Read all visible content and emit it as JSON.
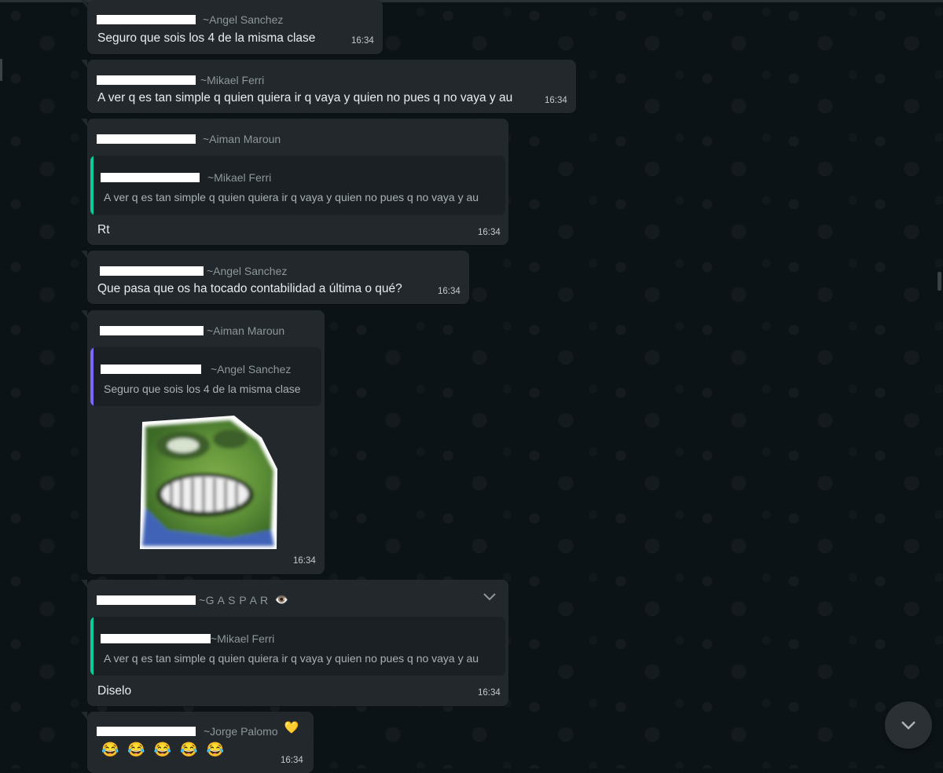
{
  "messages": [
    {
      "sender": "~Angel Sanchez",
      "text": "Seguro que sois los 4 de la misma clase",
      "time": "16:34"
    },
    {
      "sender": "~Mikael Ferri",
      "text": "A ver q es tan simple q quien quiera ir q vaya y quien no pues q no vaya y au",
      "time": "16:34"
    },
    {
      "sender": "~Aiman Maroun",
      "quote": {
        "sender": "~Mikael Ferri",
        "text": "A ver q es tan simple q quien quiera ir q vaya y quien no pues q no vaya y au"
      },
      "text": "Rt",
      "time": "16:34"
    },
    {
      "sender": "~Angel Sanchez",
      "text": "Que pasa que os ha tocado contabilidad a última o qué?",
      "time": "16:34"
    },
    {
      "sender": "~Aiman Maroun",
      "quote": {
        "sender": "~Angel Sanchez",
        "text": "Seguro que sois los 4 de la misma clase"
      },
      "sticker": "pepe-sticker",
      "time": "16:34"
    },
    {
      "sender": "~G A S P A R",
      "sender_emoji": "👁️",
      "quote": {
        "sender": "~Mikael Ferri",
        "text": "A ver q es tan simple q quien quiera ir q vaya y quien no pues q no vaya y au"
      },
      "text": "Diselo",
      "time": "16:34"
    },
    {
      "sender": "~Jorge Palomo",
      "sender_emoji": "💛",
      "emojis": [
        "😂",
        "😂",
        "😂",
        "😂",
        "😂"
      ],
      "time": "16:34"
    }
  ],
  "colors": {
    "quote_green": "#06cf9c",
    "quote_purple": "#7f66ff",
    "bubble": "#22282c",
    "background": "#0c1317"
  },
  "icons": {
    "menu": "chevron-down-icon",
    "scroll_down": "chevron-down-icon"
  }
}
